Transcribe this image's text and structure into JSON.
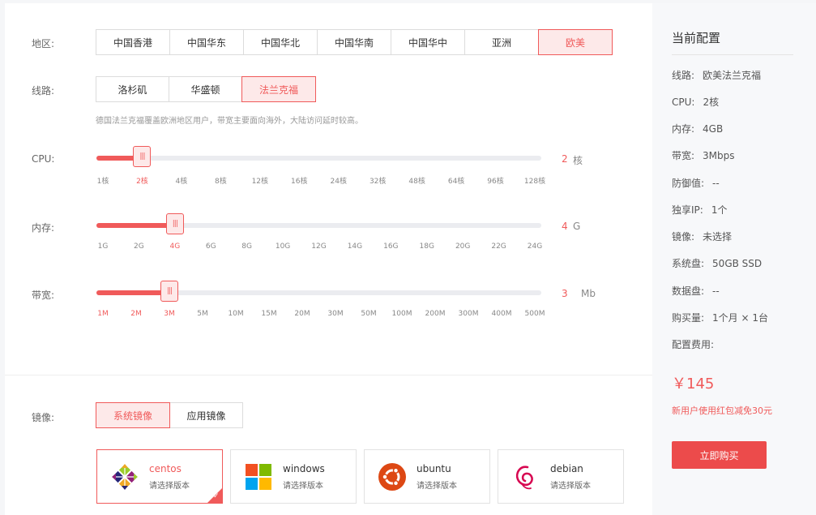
{
  "region": {
    "label": "地区:",
    "options": [
      "中国香港",
      "中国华东",
      "中国华北",
      "中国华南",
      "中国华中",
      "亚洲",
      "欧美"
    ],
    "selected": "欧美"
  },
  "line": {
    "label": "线路:",
    "options": [
      "洛杉矶",
      "华盛顿",
      "法兰克福"
    ],
    "selected": "法兰克福",
    "hint": "德国法兰克福覆盖欧洲地区用户，带宽主要面向海外，大陆访问延时较高。"
  },
  "cpu": {
    "label": "CPU:",
    "ticks": [
      "1核",
      "2核",
      "4核",
      "8核",
      "12核",
      "16核",
      "24核",
      "32核",
      "48核",
      "64核",
      "96核",
      "128核"
    ],
    "selected_index": 1,
    "value": "2",
    "unit": "核"
  },
  "memory": {
    "label": "内存:",
    "ticks": [
      "1G",
      "2G",
      "4G",
      "6G",
      "8G",
      "10G",
      "12G",
      "14G",
      "16G",
      "18G",
      "20G",
      "22G",
      "24G"
    ],
    "selected_index": 2,
    "value": "4",
    "unit": "G"
  },
  "bandwidth": {
    "label": "带宽:",
    "ticks": [
      "1M",
      "2M",
      "3M",
      "5M",
      "10M",
      "15M",
      "20M",
      "30M",
      "50M",
      "100M",
      "200M",
      "300M",
      "400M",
      "500M"
    ],
    "selected_index": 2,
    "value": "3",
    "unit": "Mb"
  },
  "image": {
    "label": "镜像:",
    "tabs": [
      "系统镜像",
      "应用镜像"
    ],
    "selected_tab": "系统镜像",
    "os": [
      {
        "name": "centos",
        "version": "请选择版本",
        "selected": true
      },
      {
        "name": "windows",
        "version": "请选择版本",
        "selected": false
      },
      {
        "name": "ubuntu",
        "version": "请选择版本",
        "selected": false
      },
      {
        "name": "debian",
        "version": "请选择版本",
        "selected": false
      }
    ]
  },
  "summary": {
    "title": "当前配置",
    "rows": [
      {
        "key": "线路:",
        "value": "欧美法兰克福"
      },
      {
        "key": "CPU:",
        "value": "2核"
      },
      {
        "key": "内存:",
        "value": "4GB"
      },
      {
        "key": "带宽:",
        "value": "3Mbps"
      },
      {
        "key": "防御值:",
        "value": "--"
      },
      {
        "key": "独享IP:",
        "value": "1个"
      },
      {
        "key": "镜像:",
        "value": "未选择"
      },
      {
        "key": "系统盘:",
        "value": "50GB SSD"
      },
      {
        "key": "数据盘:",
        "value": "--"
      },
      {
        "key": "购买量:",
        "value": "1个月 × 1台"
      },
      {
        "key": "配置费用:",
        "value": ""
      }
    ],
    "price": "￥145",
    "promo": "新用户使用红包减免30元",
    "buy_label": "立即购买"
  },
  "colors": {
    "accent": "#f05a5a",
    "button": "#ec4b4b"
  }
}
